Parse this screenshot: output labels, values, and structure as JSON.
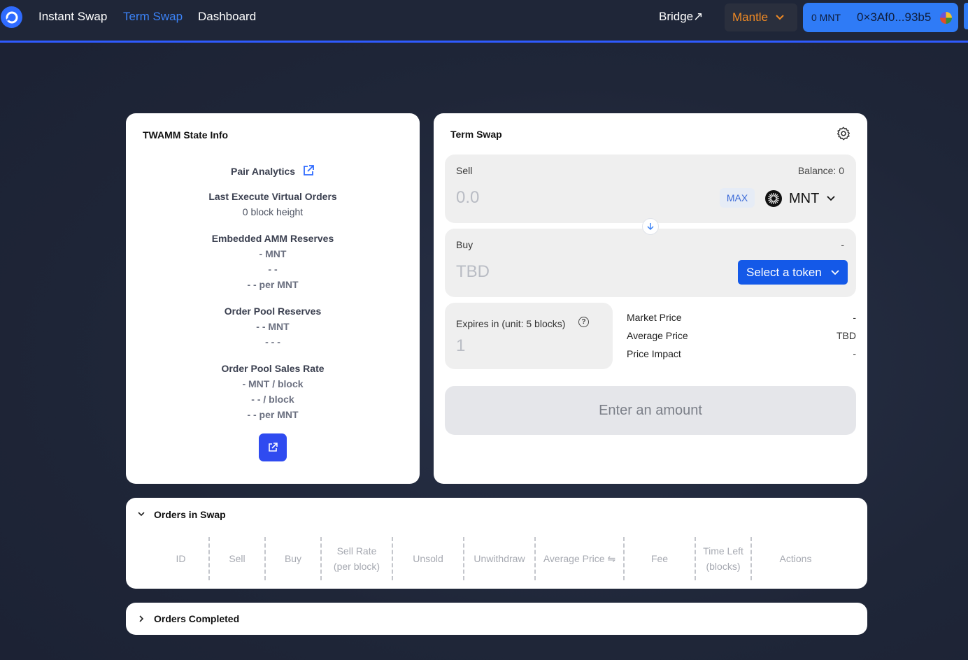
{
  "nav": {
    "links": [
      "Instant Swap",
      "Term Swap",
      "Dashboard"
    ],
    "active": "Term Swap",
    "bridge": "Bridge↗",
    "chain": "Mantle",
    "wallet_balance": "0 MNT",
    "wallet_address": "0×3Af0...93b5"
  },
  "info": {
    "title": "TWAMM State Info",
    "pair_analytics": "Pair Analytics",
    "last_execute_title": "Last Execute Virtual Orders",
    "last_execute_value": "0 block height",
    "amm_reserves_title": "Embedded AMM Reserves",
    "amm_reserves": [
      "-  MNT",
      "-  -",
      "-  - per MNT"
    ],
    "pool_reserves_title": "Order Pool Reserves",
    "pool_reserves": [
      "- -  MNT",
      "- -  -"
    ],
    "sales_rate_title": "Order Pool Sales Rate",
    "sales_rate": [
      "-  MNT / block",
      "-  - / block",
      "-  - per MNT"
    ]
  },
  "swap": {
    "title": "Term Swap",
    "sell_label": "Sell",
    "balance": "Balance: 0",
    "sell_placeholder": "0.0",
    "max_label": "MAX",
    "sell_token": "MNT",
    "buy_label": "Buy",
    "buy_right": "-",
    "buy_placeholder": "TBD",
    "select_token": "Select a token",
    "expires_label": "Expires in (unit: 5 blocks)",
    "expires_value": "1",
    "stats": [
      {
        "label": "Market Price",
        "value": "-"
      },
      {
        "label": "Average Price",
        "value": "TBD"
      },
      {
        "label": "Price Impact",
        "value": "-"
      }
    ],
    "submit": "Enter an amount"
  },
  "orders": {
    "title": "Orders in Swap",
    "columns": [
      "ID",
      "Sell",
      "Buy",
      "Sell Rate\n(per block)",
      "Unsold",
      "Unwithdraw",
      "Average Price ⇋",
      "Fee",
      "Time Left\n(blocks)",
      "Actions"
    ]
  },
  "completed": {
    "title": "Orders Completed"
  },
  "colors": {
    "accent": "#2f5bff",
    "chain": "#f08a24",
    "primary_button": "#1459e8"
  }
}
